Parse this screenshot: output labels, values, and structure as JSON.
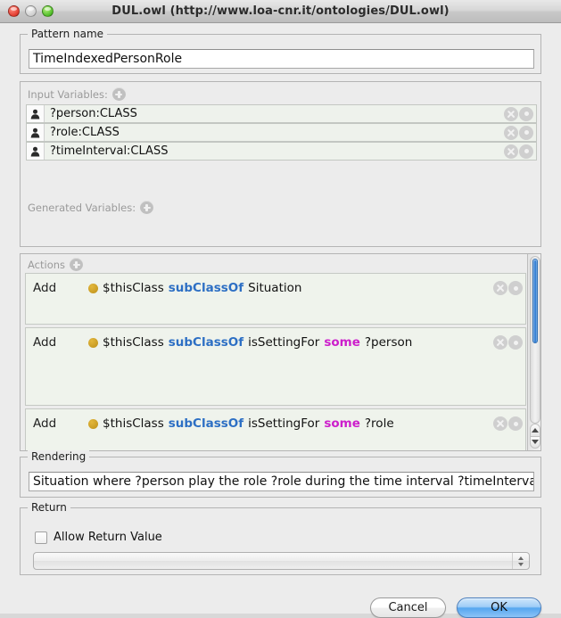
{
  "window": {
    "title": "DUL.owl (http://www.loa-cnr.it/ontologies/DUL.owl)",
    "controls": {
      "close": "close",
      "minimize": "minimize",
      "zoom": "zoom"
    }
  },
  "pattern_name": {
    "group_label": "Pattern name",
    "value": "TimeIndexedPersonRole"
  },
  "variables": {
    "input_label": "Input Variables:",
    "generated_label": "Generated Variables:",
    "add_icon": "plus-icon",
    "input_items": [
      {
        "icon": "person-icon",
        "text": "?person:CLASS"
      },
      {
        "icon": "person-icon",
        "text": "?role:CLASS"
      },
      {
        "icon": "person-icon",
        "text": "?timeInterval:CLASS"
      }
    ],
    "generated_items": [],
    "row_buttons": {
      "delete": "close-icon",
      "edit": "dot-icon"
    }
  },
  "actions": {
    "label": "Actions",
    "add_icon": "plus-icon",
    "items": [
      {
        "verb": "Add",
        "bullet": "class-bullet-icon",
        "tokens": [
          {
            "text": "$thisClass",
            "style": "plain"
          },
          {
            "text": "subClassOf",
            "style": "property"
          },
          {
            "text": "Situation",
            "style": "plain"
          }
        ]
      },
      {
        "verb": "Add",
        "bullet": "class-bullet-icon",
        "tokens": [
          {
            "text": "$thisClass",
            "style": "plain"
          },
          {
            "text": "subClassOf",
            "style": "property"
          },
          {
            "text": "isSettingFor",
            "style": "plain"
          },
          {
            "text": "some",
            "style": "quantifier"
          },
          {
            "text": "?person",
            "style": "plain"
          }
        ]
      },
      {
        "verb": "Add",
        "bullet": "class-bullet-icon",
        "tokens": [
          {
            "text": "$thisClass",
            "style": "plain"
          },
          {
            "text": "subClassOf",
            "style": "property"
          },
          {
            "text": "isSettingFor",
            "style": "plain"
          },
          {
            "text": "some",
            "style": "quantifier"
          },
          {
            "text": "?role",
            "style": "plain"
          }
        ]
      }
    ],
    "scrollbar": {
      "up_arrow": "triangle-up-icon",
      "down_arrow": "triangle-down-icon"
    }
  },
  "rendering": {
    "group_label": "Rendering",
    "value": "Situation where ?person play the role ?role during the time interval ?timeInterval"
  },
  "return_section": {
    "group_label": "Return",
    "checkbox_label": "Allow Return Value",
    "checked": false,
    "select_value": "",
    "select_placeholder": ""
  },
  "footer": {
    "cancel_label": "Cancel",
    "ok_label": "OK"
  },
  "colors": {
    "property": "#2d6fc4",
    "quantifier": "#cc1ecb",
    "bullet": "#c79a22",
    "dialog_bg": "#ececec",
    "row_bg": "#eef2ec",
    "default_button": "#56a6ef"
  }
}
